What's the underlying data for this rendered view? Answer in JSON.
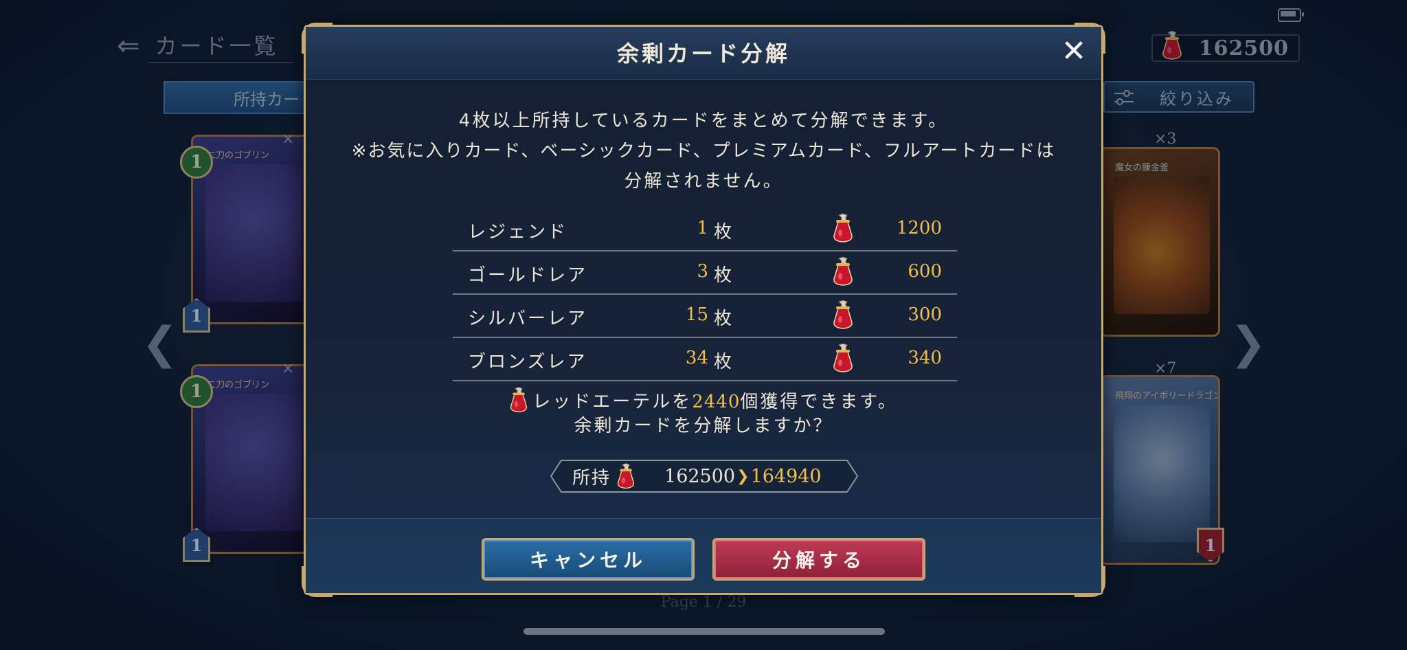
{
  "background": {
    "back_title": "カード一覧",
    "owned_tab_label": "所持カー",
    "currency_value": "162500",
    "filter_label": "絞り込み",
    "page_indicator": "Page  1  /  29",
    "cards": {
      "top_left": {
        "name": "二刀のゴブリン",
        "cost": "1",
        "rarity": "1",
        "copies": "×"
      },
      "bottom_left": {
        "name": "二刀のゴブリン",
        "cost": "1",
        "rarity": "1",
        "copies": "×"
      },
      "top_right": {
        "name": "魔女の錬金釜",
        "copies": "×3"
      },
      "bottom_right": {
        "name": "飛翔のアイボリードラゴン",
        "copies": "×7",
        "rarity": "1"
      }
    }
  },
  "modal": {
    "title": "余剰カード分解",
    "close_label": "✕",
    "description": [
      "4枚以上所持しているカードをまとめて分解できます。",
      "※お気に入りカード、ベーシックカード、プレミアムカード、フルアートカードは",
      "分解されません。"
    ],
    "rows": [
      {
        "name": "レジェンド",
        "count": "1",
        "unit": "枚",
        "amount": "1200"
      },
      {
        "name": "ゴールドレア",
        "count": "3",
        "unit": "枚",
        "amount": "600"
      },
      {
        "name": "シルバーレア",
        "count": "15",
        "unit": "枚",
        "amount": "300"
      },
      {
        "name": "ブロンズレア",
        "count": "34",
        "unit": "枚",
        "amount": "340"
      }
    ],
    "gain": {
      "prefix": "レッドエーテルを",
      "amount": "2440",
      "suffix": "個獲得できます。"
    },
    "confirm_text": "余剰カードを分解しますか？",
    "owned": {
      "label": "所持",
      "from": "162500",
      "arrow": "❯",
      "to": "164940"
    },
    "cancel_label": "キャンセル",
    "ok_label": "分解する"
  },
  "icons": {
    "currency": "red-ether-icon",
    "close": "close-icon",
    "back": "back-arrow-icon",
    "filter": "filter-icon",
    "nav_left": "chevron-left-icon",
    "nav_right": "chevron-right-icon"
  },
  "colors": {
    "accent_gold": "#f2c04a",
    "frame_gold": "#c9a96a",
    "cancel_blue": "#2a6fa6",
    "confirm_red": "#c03a55"
  }
}
